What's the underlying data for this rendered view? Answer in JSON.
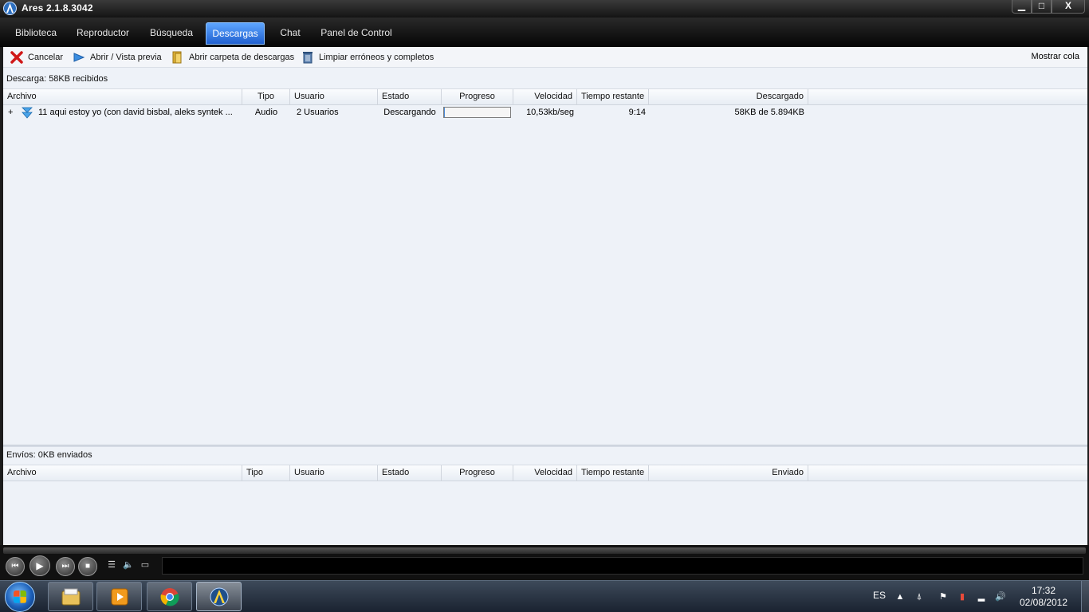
{
  "window": {
    "title": "Ares 2.1.8.3042",
    "minimize": "▁",
    "maximize": "□",
    "close": "X"
  },
  "nav": {
    "tabs": [
      {
        "label": "Biblioteca"
      },
      {
        "label": "Reproductor"
      },
      {
        "label": "Búsqueda"
      },
      {
        "label": "Descargas",
        "active": true
      },
      {
        "label": "Chat"
      },
      {
        "label": "Panel de Control"
      }
    ]
  },
  "toolbar": {
    "cancel": "Cancelar",
    "open_preview": "Abrir / Vista previa",
    "open_folder": "Abrir carpeta de descargas",
    "clear": "Limpiar erróneos y completos",
    "show_queue": "Mostrar cola"
  },
  "downloads": {
    "summary": "Descarga: 58KB recibidos",
    "columns": {
      "file": "Archivo",
      "type": "Tipo",
      "user": "Usuario",
      "status": "Estado",
      "progress": "Progreso",
      "speed": "Velocidad",
      "remaining": "Tiempo restante",
      "downloaded": "Descargado"
    },
    "rows": [
      {
        "expand": "+",
        "file": "11 aqui estoy yo (con david bisbal, aleks syntek ...",
        "type": "Audio",
        "user": "2 Usuarios",
        "status": "Descargando",
        "progress": 0.01,
        "speed": "10,53kb/seg",
        "remaining": "9:14",
        "downloaded": "58KB de 5.894KB"
      }
    ]
  },
  "uploads": {
    "summary": "Envíos: 0KB enviados",
    "columns": {
      "file": "Archivo",
      "type": "Tipo",
      "user": "Usuario",
      "status": "Estado",
      "progress": "Progreso",
      "speed": "Velocidad",
      "remaining": "Tiempo restante",
      "sent": "Enviado"
    }
  },
  "taskbar": {
    "language": "ES",
    "time": "17:32",
    "date": "02/08/2012",
    "apps": [
      "windows-explorer",
      "media-player",
      "chrome",
      "ares"
    ]
  }
}
